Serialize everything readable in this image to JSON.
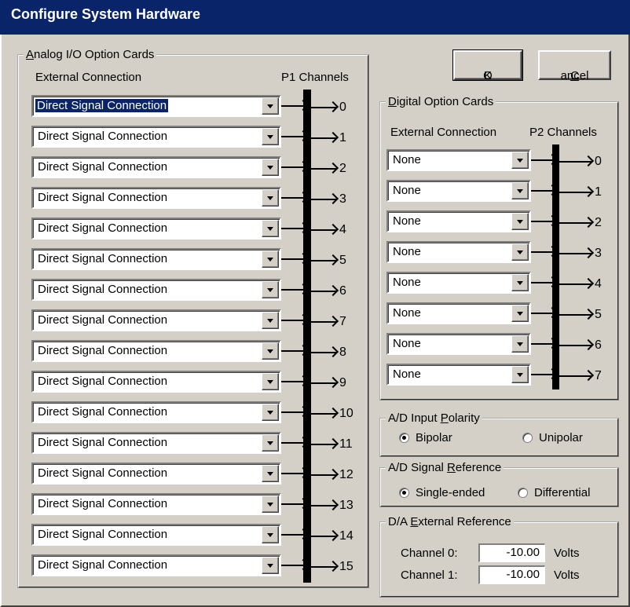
{
  "window": {
    "title": "Configure System Hardware"
  },
  "analog": {
    "legend_first": "A",
    "legend_rest": "nalog I/O Option Cards",
    "col_connection": "External Connection",
    "col_channels": "P1 Channels",
    "rows": [
      {
        "value": "Direct Signal Connection",
        "channel": "0"
      },
      {
        "value": "Direct Signal Connection",
        "channel": "1"
      },
      {
        "value": "Direct Signal Connection",
        "channel": "2"
      },
      {
        "value": "Direct Signal Connection",
        "channel": "3"
      },
      {
        "value": "Direct Signal Connection",
        "channel": "4"
      },
      {
        "value": "Direct Signal Connection",
        "channel": "5"
      },
      {
        "value": "Direct Signal Connection",
        "channel": "6"
      },
      {
        "value": "Direct Signal Connection",
        "channel": "7"
      },
      {
        "value": "Direct Signal Connection",
        "channel": "8"
      },
      {
        "value": "Direct Signal Connection",
        "channel": "9"
      },
      {
        "value": "Direct Signal Connection",
        "channel": "10"
      },
      {
        "value": "Direct Signal Connection",
        "channel": "11"
      },
      {
        "value": "Direct Signal Connection",
        "channel": "12"
      },
      {
        "value": "Direct Signal Connection",
        "channel": "13"
      },
      {
        "value": "Direct Signal Connection",
        "channel": "14"
      },
      {
        "value": "Direct Signal Connection",
        "channel": "15"
      }
    ]
  },
  "buttons": {
    "ok_first": "O",
    "ok_rest": "K",
    "cancel_first": "C",
    "cancel_rest": "ancel"
  },
  "digital": {
    "legend_first": "D",
    "legend_rest": "igital Option Cards",
    "col_connection": "External Connection",
    "col_channels": "P2 Channels",
    "rows": [
      {
        "value": "None",
        "channel": "0"
      },
      {
        "value": "None",
        "channel": "1"
      },
      {
        "value": "None",
        "channel": "2"
      },
      {
        "value": "None",
        "channel": "3"
      },
      {
        "value": "None",
        "channel": "4"
      },
      {
        "value": "None",
        "channel": "5"
      },
      {
        "value": "None",
        "channel": "6"
      },
      {
        "value": "None",
        "channel": "7"
      }
    ]
  },
  "polarity": {
    "legend_pre": "A/D Input ",
    "legend_u": "P",
    "legend_post": "olarity",
    "options": [
      "Bipolar",
      "Unipolar"
    ],
    "selected": 0
  },
  "reference": {
    "legend_pre": "A/D Signal ",
    "legend_u": "R",
    "legend_post": "eference",
    "options": [
      "Single-ended",
      "Differential"
    ],
    "selected": 0
  },
  "da_ref": {
    "legend_pre": "D/A ",
    "legend_u": "E",
    "legend_post": "xternal Reference",
    "channels": [
      {
        "label": "Channel 0:",
        "value": "-10.00",
        "unit": "Volts"
      },
      {
        "label": "Channel 1:",
        "value": "-10.00",
        "unit": "Volts"
      }
    ]
  }
}
